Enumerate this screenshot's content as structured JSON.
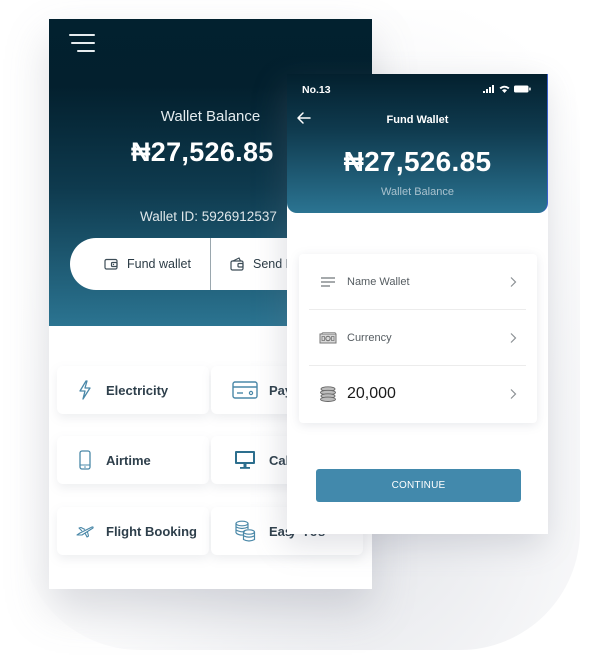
{
  "back_screen": {
    "balance_label": "Wallet Balance",
    "balance": "₦27,526.85",
    "wallet_id": "Wallet ID: 5926912537",
    "actions": [
      {
        "label": "Fund wallet",
        "icon": "wallet-icon"
      },
      {
        "label": "Send M",
        "icon": "wallet-send-icon"
      }
    ],
    "services": [
      {
        "label": "Electricity",
        "icon": "lightning-icon"
      },
      {
        "label": "Pay",
        "icon": "credit-card-icon"
      },
      {
        "label": "Airtime",
        "icon": "mobile-phone-icon"
      },
      {
        "label": "Cab",
        "icon": "monitor-icon"
      },
      {
        "label": "Flight Booking",
        "icon": "airplane-icon"
      },
      {
        "label": "Eas",
        "icon": "coins-stack-icon"
      }
    ],
    "services_overflow_text": "y Tes",
    "accent_color": "#4a88a8"
  },
  "front_screen": {
    "status_time": "No.13",
    "title": "Fund Wallet",
    "balance": "₦27,526.85",
    "balance_label": "Wallet Balance",
    "form": [
      {
        "label": "Name Wallet",
        "icon": "lines-icon"
      },
      {
        "label": "Currency",
        "icon": "banknote-icon"
      },
      {
        "value": "20,000",
        "icon": "coins-icon"
      }
    ],
    "continue_label": "CONTINUE",
    "button_color": "#4289ac"
  }
}
